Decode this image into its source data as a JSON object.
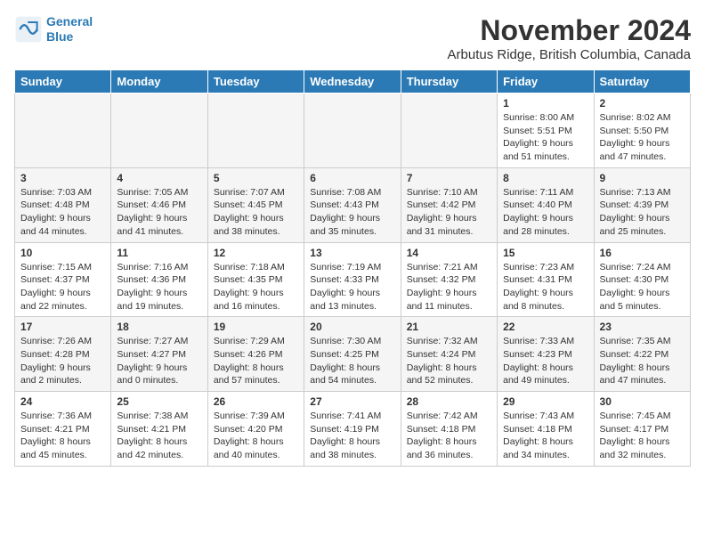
{
  "header": {
    "logo_line1": "General",
    "logo_line2": "Blue",
    "month_title": "November 2024",
    "location": "Arbutus Ridge, British Columbia, Canada"
  },
  "weekdays": [
    "Sunday",
    "Monday",
    "Tuesday",
    "Wednesday",
    "Thursday",
    "Friday",
    "Saturday"
  ],
  "weeks": [
    [
      {
        "day": "",
        "info": ""
      },
      {
        "day": "",
        "info": ""
      },
      {
        "day": "",
        "info": ""
      },
      {
        "day": "",
        "info": ""
      },
      {
        "day": "",
        "info": ""
      },
      {
        "day": "1",
        "info": "Sunrise: 8:00 AM\nSunset: 5:51 PM\nDaylight: 9 hours\nand 51 minutes."
      },
      {
        "day": "2",
        "info": "Sunrise: 8:02 AM\nSunset: 5:50 PM\nDaylight: 9 hours\nand 47 minutes."
      }
    ],
    [
      {
        "day": "3",
        "info": "Sunrise: 7:03 AM\nSunset: 4:48 PM\nDaylight: 9 hours\nand 44 minutes."
      },
      {
        "day": "4",
        "info": "Sunrise: 7:05 AM\nSunset: 4:46 PM\nDaylight: 9 hours\nand 41 minutes."
      },
      {
        "day": "5",
        "info": "Sunrise: 7:07 AM\nSunset: 4:45 PM\nDaylight: 9 hours\nand 38 minutes."
      },
      {
        "day": "6",
        "info": "Sunrise: 7:08 AM\nSunset: 4:43 PM\nDaylight: 9 hours\nand 35 minutes."
      },
      {
        "day": "7",
        "info": "Sunrise: 7:10 AM\nSunset: 4:42 PM\nDaylight: 9 hours\nand 31 minutes."
      },
      {
        "day": "8",
        "info": "Sunrise: 7:11 AM\nSunset: 4:40 PM\nDaylight: 9 hours\nand 28 minutes."
      },
      {
        "day": "9",
        "info": "Sunrise: 7:13 AM\nSunset: 4:39 PM\nDaylight: 9 hours\nand 25 minutes."
      }
    ],
    [
      {
        "day": "10",
        "info": "Sunrise: 7:15 AM\nSunset: 4:37 PM\nDaylight: 9 hours\nand 22 minutes."
      },
      {
        "day": "11",
        "info": "Sunrise: 7:16 AM\nSunset: 4:36 PM\nDaylight: 9 hours\nand 19 minutes."
      },
      {
        "day": "12",
        "info": "Sunrise: 7:18 AM\nSunset: 4:35 PM\nDaylight: 9 hours\nand 16 minutes."
      },
      {
        "day": "13",
        "info": "Sunrise: 7:19 AM\nSunset: 4:33 PM\nDaylight: 9 hours\nand 13 minutes."
      },
      {
        "day": "14",
        "info": "Sunrise: 7:21 AM\nSunset: 4:32 PM\nDaylight: 9 hours\nand 11 minutes."
      },
      {
        "day": "15",
        "info": "Sunrise: 7:23 AM\nSunset: 4:31 PM\nDaylight: 9 hours\nand 8 minutes."
      },
      {
        "day": "16",
        "info": "Sunrise: 7:24 AM\nSunset: 4:30 PM\nDaylight: 9 hours\nand 5 minutes."
      }
    ],
    [
      {
        "day": "17",
        "info": "Sunrise: 7:26 AM\nSunset: 4:28 PM\nDaylight: 9 hours\nand 2 minutes."
      },
      {
        "day": "18",
        "info": "Sunrise: 7:27 AM\nSunset: 4:27 PM\nDaylight: 9 hours\nand 0 minutes."
      },
      {
        "day": "19",
        "info": "Sunrise: 7:29 AM\nSunset: 4:26 PM\nDaylight: 8 hours\nand 57 minutes."
      },
      {
        "day": "20",
        "info": "Sunrise: 7:30 AM\nSunset: 4:25 PM\nDaylight: 8 hours\nand 54 minutes."
      },
      {
        "day": "21",
        "info": "Sunrise: 7:32 AM\nSunset: 4:24 PM\nDaylight: 8 hours\nand 52 minutes."
      },
      {
        "day": "22",
        "info": "Sunrise: 7:33 AM\nSunset: 4:23 PM\nDaylight: 8 hours\nand 49 minutes."
      },
      {
        "day": "23",
        "info": "Sunrise: 7:35 AM\nSunset: 4:22 PM\nDaylight: 8 hours\nand 47 minutes."
      }
    ],
    [
      {
        "day": "24",
        "info": "Sunrise: 7:36 AM\nSunset: 4:21 PM\nDaylight: 8 hours\nand 45 minutes."
      },
      {
        "day": "25",
        "info": "Sunrise: 7:38 AM\nSunset: 4:21 PM\nDaylight: 8 hours\nand 42 minutes."
      },
      {
        "day": "26",
        "info": "Sunrise: 7:39 AM\nSunset: 4:20 PM\nDaylight: 8 hours\nand 40 minutes."
      },
      {
        "day": "27",
        "info": "Sunrise: 7:41 AM\nSunset: 4:19 PM\nDaylight: 8 hours\nand 38 minutes."
      },
      {
        "day": "28",
        "info": "Sunrise: 7:42 AM\nSunset: 4:18 PM\nDaylight: 8 hours\nand 36 minutes."
      },
      {
        "day": "29",
        "info": "Sunrise: 7:43 AM\nSunset: 4:18 PM\nDaylight: 8 hours\nand 34 minutes."
      },
      {
        "day": "30",
        "info": "Sunrise: 7:45 AM\nSunset: 4:17 PM\nDaylight: 8 hours\nand 32 minutes."
      }
    ]
  ]
}
